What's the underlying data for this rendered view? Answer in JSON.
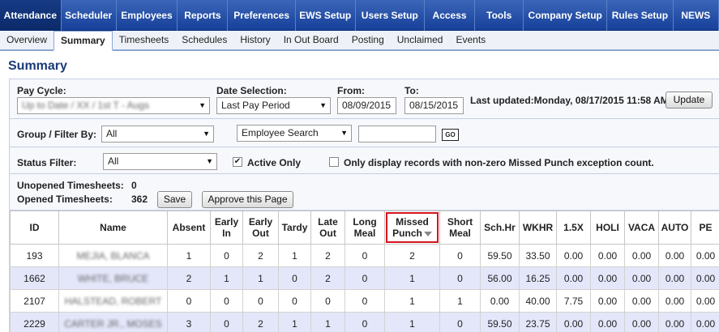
{
  "topnav": {
    "items": [
      {
        "label": "Attendance",
        "name": "nav-attendance",
        "active": true
      },
      {
        "label": "Scheduler",
        "name": "nav-scheduler"
      },
      {
        "label": "Employees",
        "name": "nav-employees"
      },
      {
        "label": "Reports",
        "name": "nav-reports"
      },
      {
        "label": "Preferences",
        "name": "nav-preferences"
      },
      {
        "label": "EWS Setup",
        "name": "nav-ews-setup"
      },
      {
        "label": "Users Setup",
        "name": "nav-users-setup"
      },
      {
        "label": "Access",
        "name": "nav-access"
      },
      {
        "label": "Tools",
        "name": "nav-tools"
      },
      {
        "label": "Company Setup",
        "name": "nav-company-setup"
      },
      {
        "label": "Rules Setup",
        "name": "nav-rules-setup"
      },
      {
        "label": "NEWS",
        "name": "nav-news"
      }
    ]
  },
  "subnav": {
    "items": [
      {
        "label": "Overview",
        "name": "subnav-overview"
      },
      {
        "label": "Summary",
        "name": "subnav-summary",
        "active": true
      },
      {
        "label": "Timesheets",
        "name": "subnav-timesheets"
      },
      {
        "label": "Schedules",
        "name": "subnav-schedules"
      },
      {
        "label": "History",
        "name": "subnav-history"
      },
      {
        "label": "In Out Board",
        "name": "subnav-in-out-board"
      },
      {
        "label": "Posting",
        "name": "subnav-posting"
      },
      {
        "label": "Unclaimed",
        "name": "subnav-unclaimed"
      },
      {
        "label": "Events",
        "name": "subnav-events"
      }
    ]
  },
  "page": {
    "title": "Summary"
  },
  "filters": {
    "pay_cycle_label": "Pay Cycle:",
    "pay_cycle_value": "Up to Date / XX / 1st T - Augs",
    "date_selection_label": "Date Selection:",
    "date_selection_value": "Last Pay Period",
    "from_label": "From:",
    "from_value": "08/09/2015",
    "to_label": "To:",
    "to_value": "08/15/2015",
    "last_updated": "Last updated:Monday, 08/17/2015 11:58 AM",
    "update_button": "Update",
    "group_filter_label": "Group / Filter By:",
    "group_filter_value": "All",
    "employee_search_value": "Employee Search",
    "search_input_value": "",
    "go_button": "GO",
    "status_filter_label": "Status Filter:",
    "status_filter_value": "All",
    "active_only_label": "Active Only",
    "active_only_checked": true,
    "nonzero_label": "Only display records with non-zero Missed Punch exception count.",
    "nonzero_checked": false,
    "unopened_label": "Unopened Timesheets:",
    "unopened_count": "0",
    "opened_label": "Opened Timesheets:",
    "opened_count": "362",
    "save_button": "Save",
    "approve_button": "Approve this Page"
  },
  "grid": {
    "highlight_color": "#d8141d",
    "columns": [
      "ID",
      "Name",
      "Absent",
      "Early In",
      "Early Out",
      "Tardy",
      "Late Out",
      "Long Meal",
      "Missed Punch",
      "Short Meal",
      "Sch.Hr",
      "WKHR",
      "1.5X",
      "HOLI",
      "VACA",
      "AUTO",
      "PE"
    ],
    "rows": [
      [
        "193",
        "MEJIA, BLANCA",
        "1",
        "0",
        "2",
        "1",
        "2",
        "0",
        "2",
        "0",
        "59.50",
        "33.50",
        "0.00",
        "0.00",
        "0.00",
        "0.00",
        "0.00"
      ],
      [
        "1662",
        "WHITE, BRUCE",
        "2",
        "1",
        "1",
        "0",
        "2",
        "0",
        "1",
        "0",
        "56.00",
        "16.25",
        "0.00",
        "0.00",
        "0.00",
        "0.00",
        "0.00"
      ],
      [
        "2107",
        "HALSTEAD, ROBERT",
        "0",
        "0",
        "0",
        "0",
        "0",
        "0",
        "1",
        "1",
        "0.00",
        "40.00",
        "7.75",
        "0.00",
        "0.00",
        "0.00",
        "0.00"
      ],
      [
        "2229",
        "CARTER JR., MOSES",
        "3",
        "0",
        "2",
        "1",
        "1",
        "0",
        "1",
        "0",
        "59.50",
        "23.75",
        "0.00",
        "0.00",
        "0.00",
        "0.00",
        "0.00"
      ]
    ]
  }
}
